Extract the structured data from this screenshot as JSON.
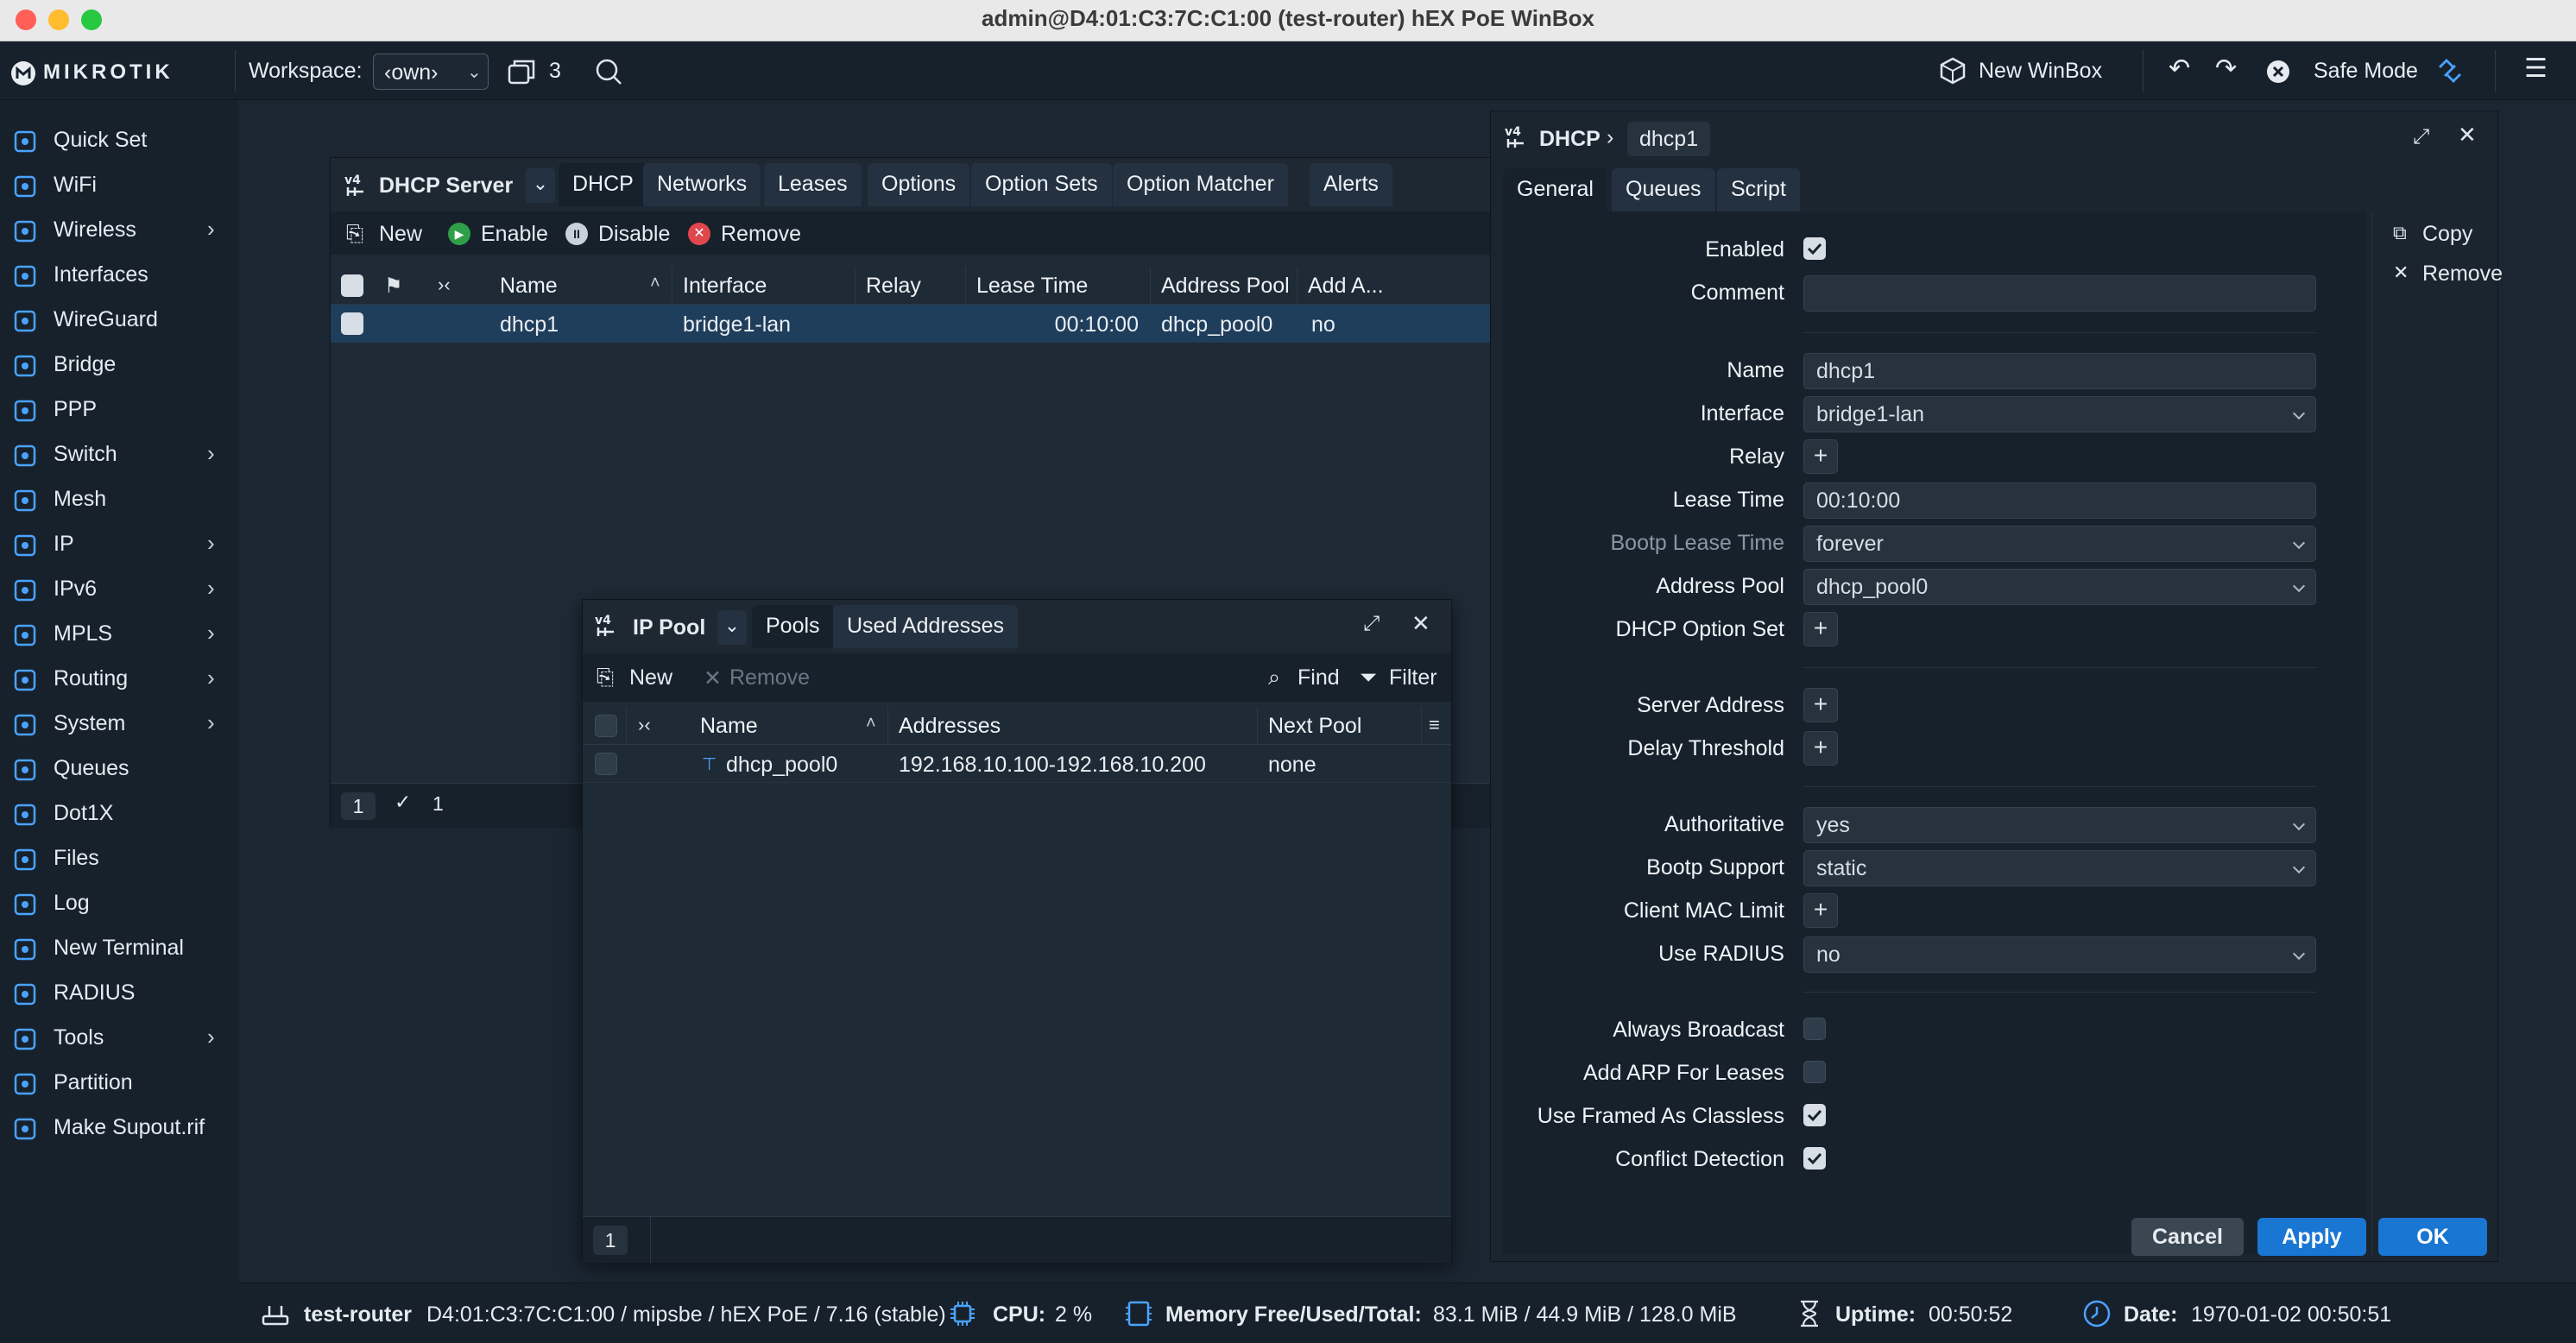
{
  "window_title": "admin@D4:01:C3:7C:C1:00 (test-router) hEX PoE WinBox",
  "topbar": {
    "brand": "MIKROTIK",
    "workspace_label": "Workspace:",
    "workspace_value": "‹own›",
    "windows_count": "3",
    "new_winbox": "New WinBox",
    "safe_mode": "Safe Mode"
  },
  "sidebar": {
    "items": [
      {
        "label": "Quick Set",
        "icon": "wand-icon",
        "sub": false
      },
      {
        "label": "WiFi",
        "icon": "wifi-icon",
        "sub": false
      },
      {
        "label": "Wireless",
        "icon": "antenna-icon",
        "sub": true
      },
      {
        "label": "Interfaces",
        "icon": "interfaces-icon",
        "sub": false
      },
      {
        "label": "WireGuard",
        "icon": "shield-icon",
        "sub": false
      },
      {
        "label": "Bridge",
        "icon": "bridge-icon",
        "sub": false
      },
      {
        "label": "PPP",
        "icon": "ppp-icon",
        "sub": false
      },
      {
        "label": "Switch",
        "icon": "switch-icon",
        "sub": true
      },
      {
        "label": "Mesh",
        "icon": "mesh-icon",
        "sub": false
      },
      {
        "label": "IP",
        "icon": "ipv4-icon",
        "sub": true
      },
      {
        "label": "IPv6",
        "icon": "ipv6-icon",
        "sub": true
      },
      {
        "label": "MPLS",
        "icon": "tag-icon",
        "sub": true
      },
      {
        "label": "Routing",
        "icon": "routing-icon",
        "sub": true
      },
      {
        "label": "System",
        "icon": "gear-icon",
        "sub": true
      },
      {
        "label": "Queues",
        "icon": "queues-icon",
        "sub": false
      },
      {
        "label": "Dot1X",
        "icon": "dot1x-icon",
        "sub": false
      },
      {
        "label": "Files",
        "icon": "folder-icon",
        "sub": false
      },
      {
        "label": "Log",
        "icon": "log-icon",
        "sub": false
      },
      {
        "label": "New Terminal",
        "icon": "terminal-icon",
        "sub": false
      },
      {
        "label": "RADIUS",
        "icon": "radius-icon",
        "sub": false
      },
      {
        "label": "Tools",
        "icon": "tools-icon",
        "sub": true
      },
      {
        "label": "Partition",
        "icon": "partition-icon",
        "sub": false
      },
      {
        "label": "Make Supout.rif",
        "icon": "supout-icon",
        "sub": false
      }
    ]
  },
  "dhcp_window": {
    "title": "DHCP Server",
    "tabs": [
      "DHCP",
      "Networks",
      "Leases",
      "Options",
      "Option Sets",
      "Option Matcher",
      "Alerts"
    ],
    "toolbar": {
      "new": "New",
      "enable": "Enable",
      "disable": "Disable",
      "remove": "Remove"
    },
    "columns": [
      "Name",
      "Interface",
      "Relay",
      "Lease Time",
      "Address Pool",
      "Add A..."
    ],
    "rows": [
      {
        "name": "dhcp1",
        "interface": "bridge1-lan",
        "relay": "",
        "lease_time": "00:10:00",
        "address_pool": "dhcp_pool0",
        "add_arp": "no"
      }
    ],
    "footer_count": "1",
    "footer_selected": "1"
  },
  "pool_window": {
    "title": "IP Pool",
    "tabs": [
      "Pools",
      "Used Addresses"
    ],
    "toolbar": {
      "new": "New",
      "remove": "Remove",
      "find": "Find",
      "filter": "Filter"
    },
    "columns": [
      "Name",
      "Addresses",
      "Next Pool"
    ],
    "rows": [
      {
        "name": "dhcp_pool0",
        "addresses": "192.168.10.100-192.168.10.200",
        "next_pool": "none"
      }
    ],
    "footer_count": "1"
  },
  "detail_window": {
    "breadcrumb_root": "DHCP",
    "breadcrumb_item": "dhcp1",
    "tabs": [
      "General",
      "Queues",
      "Script"
    ],
    "side_actions": {
      "copy": "Copy",
      "remove": "Remove"
    },
    "labels": {
      "enabled": "Enabled",
      "comment": "Comment",
      "name": "Name",
      "interface": "Interface",
      "relay": "Relay",
      "lease_time": "Lease Time",
      "bootp_lease_time": "Bootp Lease Time",
      "address_pool": "Address Pool",
      "dhcp_option_set": "DHCP Option Set",
      "server_address": "Server Address",
      "delay_threshold": "Delay Threshold",
      "authoritative": "Authoritative",
      "bootp_support": "Bootp Support",
      "client_mac_limit": "Client MAC Limit",
      "use_radius": "Use RADIUS",
      "always_broadcast": "Always Broadcast",
      "add_arp": "Add ARP For Leases",
      "use_framed": "Use Framed As Classless",
      "conflict_detection": "Conflict Detection"
    },
    "values": {
      "comment": "",
      "name": "dhcp1",
      "interface": "bridge1-lan",
      "lease_time": "00:10:00",
      "bootp_lease_time": "forever",
      "address_pool": "dhcp_pool0",
      "authoritative": "yes",
      "bootp_support": "static",
      "use_radius": "no"
    },
    "buttons": {
      "cancel": "Cancel",
      "apply": "Apply",
      "ok": "OK"
    }
  },
  "statusbar": {
    "router": "test-router",
    "router_info": "D4:01:C3:7C:C1:00 / mipsbe / hEX PoE / 7.16 (stable)",
    "cpu_label": "CPU:",
    "cpu_value": "2 %",
    "memory_label": "Memory Free/Used/Total:",
    "memory_value": "83.1 MiB / 44.9 MiB / 128.0 MiB",
    "uptime_label": "Uptime:",
    "uptime_value": "00:50:52",
    "date_label": "Date:",
    "date_value": "1970-01-02 00:50:51"
  },
  "colors": {
    "accent": "#1976d2",
    "close": "#ff5f57",
    "minimize": "#febc2e",
    "maximize": "#28c840",
    "enable_green": "#2e9e48",
    "remove_red": "#e0474c",
    "selection": "#1f3e5c"
  }
}
